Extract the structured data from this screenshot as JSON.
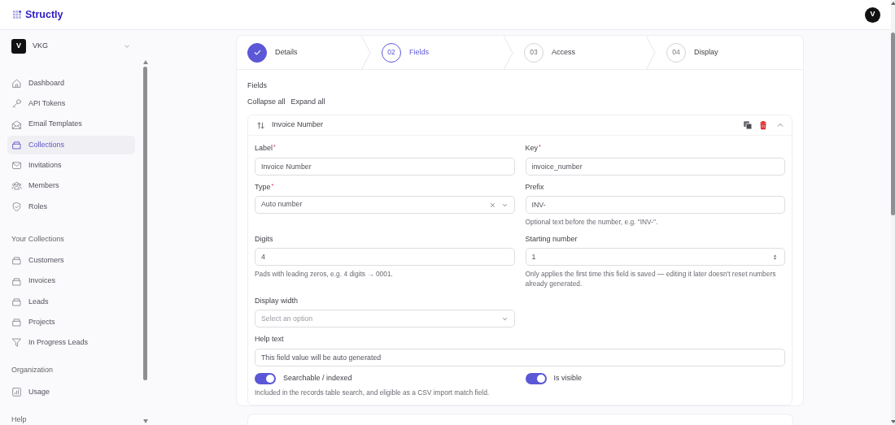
{
  "app": {
    "name": "Structly"
  },
  "user": {
    "initial": "V"
  },
  "workspace": {
    "initial": "V",
    "name": "VKG"
  },
  "sidebar": {
    "sections": [
      {
        "items": [
          {
            "label": "Dashboard",
            "kind": "home",
            "selected": false
          },
          {
            "label": "API Tokens",
            "kind": "key",
            "selected": false
          },
          {
            "label": "Email Templates",
            "kind": "open-mail",
            "selected": false
          },
          {
            "label": "Collections",
            "kind": "tray",
            "selected": true
          },
          {
            "label": "Invitations",
            "kind": "mail",
            "selected": false
          },
          {
            "label": "Members",
            "kind": "people",
            "selected": false
          },
          {
            "label": "Roles",
            "kind": "shield",
            "selected": false
          }
        ]
      },
      {
        "heading": "Your Collections",
        "items": [
          {
            "label": "Customers",
            "kind": "tray",
            "selected": false
          },
          {
            "label": "Invoices",
            "kind": "tray",
            "selected": false
          },
          {
            "label": "Leads",
            "kind": "tray",
            "selected": false
          },
          {
            "label": "Projects",
            "kind": "tray",
            "selected": false
          },
          {
            "label": "In Progress Leads",
            "kind": "funnel",
            "selected": false
          }
        ]
      },
      {
        "heading": "Organization",
        "items": [
          {
            "label": "Usage",
            "kind": "chart",
            "selected": false
          }
        ]
      },
      {
        "heading": "Help"
      }
    ]
  },
  "steps": [
    {
      "label": "Details",
      "completed": true,
      "selected": false
    },
    {
      "number": "02",
      "label": "Fields",
      "completed": false,
      "selected": true
    },
    {
      "number": "03",
      "label": "Access",
      "completed": false,
      "selected": false
    },
    {
      "number": "04",
      "label": "Display",
      "completed": false,
      "selected": false
    }
  ],
  "fields_section": {
    "title": "Fields",
    "collapse_all": "Collapse all",
    "expand_all": "Expand all"
  },
  "field_card": {
    "title": "Invoice Number",
    "expanded": true,
    "rows": [
      {
        "cells": [
          {
            "kind": "text",
            "label": "Label",
            "required_mark": "*",
            "value": "Invoice Number"
          },
          {
            "kind": "text",
            "label": "Key",
            "required_mark": "*",
            "value": "invoice_number"
          }
        ]
      },
      {
        "cells": [
          {
            "kind": "select",
            "label": "Type",
            "required_mark": "*",
            "value": "Auto number",
            "clearable": true
          },
          {
            "kind": "text",
            "label": "Prefix",
            "value": "INV-",
            "hint": "Optional text before the number, e.g. \"INV-\"."
          }
        ]
      },
      {
        "cells": [
          {
            "kind": "text",
            "label": "Digits",
            "value": "4",
            "hint": "Pads with leading zeros, e.g. 4 digits → 0001."
          },
          {
            "kind": "number",
            "label": "Starting number",
            "value": "1",
            "hint": "Only applies the first time this field is saved — editing it later doesn't reset numbers already generated."
          }
        ]
      },
      {
        "cells": [
          {
            "kind": "select",
            "label": "Display width",
            "placeholder": "Select an option",
            "clearable": false
          }
        ]
      },
      {
        "full_width": true,
        "cells": [
          {
            "kind": "text",
            "label": "Help text",
            "value": "This field value will be auto generated"
          }
        ]
      },
      {
        "cells": [
          {
            "kind": "toggle",
            "label": "Searchable / indexed",
            "on": true,
            "hint": "Included in the records table search, and eligible as a CSV import match field."
          },
          {
            "kind": "toggle",
            "label": "Is visible",
            "on": true
          }
        ]
      }
    ]
  },
  "next_card": {
    "present": true
  }
}
